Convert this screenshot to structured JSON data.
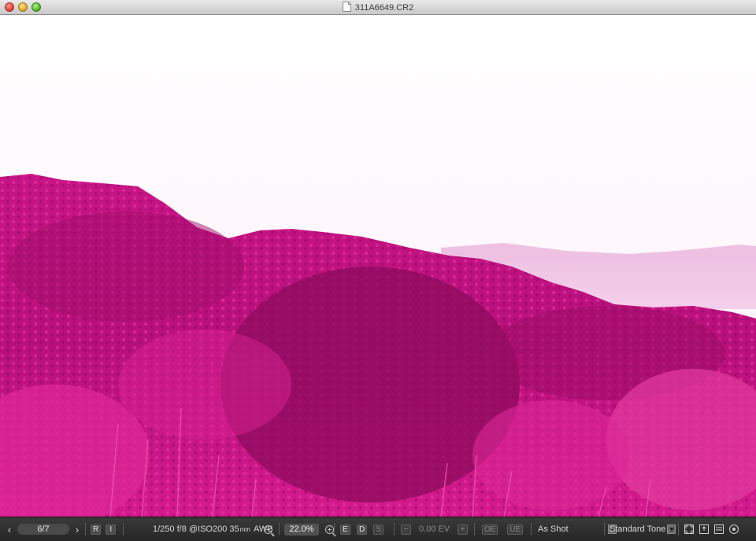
{
  "window": {
    "title": "311A6649.CR2",
    "buttons": {
      "close": "close-button",
      "minimize": "minimize-button",
      "zoom": "zoom-button"
    }
  },
  "toolbar": {
    "prev_icon": "‹",
    "counter": "6/7",
    "next_icon": "›",
    "rating_label": "R",
    "info_label": "I",
    "shooting_info": "1/250 f/8 @ISO200 35",
    "shooting_unit": "mm",
    "white_balance_short": "AWB",
    "zoom_value": "22.0%",
    "view_buttons": [
      "E",
      "D",
      "S"
    ],
    "ev_minus": "−",
    "ev_value": "0.00 EV",
    "ev_plus": "+",
    "oe_label": "OE",
    "ue_label": "UE",
    "white_balance": "As Shot",
    "picture_style": "Standard Tone"
  },
  "colors": {
    "image_tint": "#d4148a",
    "sky": "#ffffff",
    "toolbar_bg": "#2e2e2e"
  }
}
